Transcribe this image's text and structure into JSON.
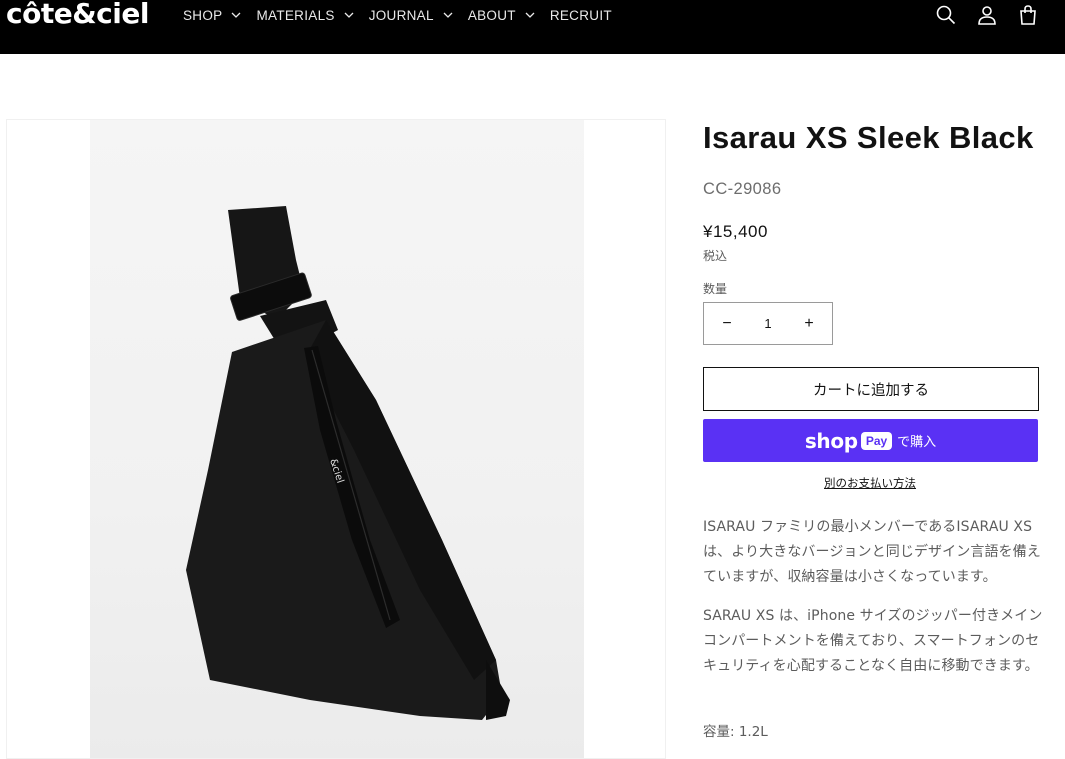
{
  "header": {
    "logo": "côte&ciel",
    "nav": [
      {
        "label": "SHOP",
        "has_dropdown": true
      },
      {
        "label": "MATERIALS",
        "has_dropdown": true
      },
      {
        "label": "JOURNAL",
        "has_dropdown": true
      },
      {
        "label": "ABOUT",
        "has_dropdown": true
      },
      {
        "label": "RECRUIT",
        "has_dropdown": false
      }
    ],
    "icons": [
      "search-icon",
      "account-icon",
      "cart-icon"
    ]
  },
  "product": {
    "title": "Isarau XS Sleek Black",
    "sku": "CC-29086",
    "price": "¥15,400",
    "tax_note": "税込",
    "quantity_label": "数量",
    "quantity_value": "1",
    "decrease_symbol": "−",
    "increase_symbol": "+",
    "add_to_cart": "カートに追加する",
    "shop_pay": {
      "shop": "shop",
      "pay": "Pay",
      "buy": "で購入"
    },
    "other_payment": "別のお支払い方法",
    "description": [
      "ISARAU ファミリの最小メンバーであるISARAU XSは、より大きなバージョンと同じデザイン言語を備えていますが、収納容量は小さくなっています。",
      "SARAU XS は、iPhone サイズのジッパー付きメインコンパートメントを備えており、スマートフォンのセキュリティを心配することなく自由に移動できます。"
    ],
    "capacity": "容量: 1.2L"
  },
  "colors": {
    "header_bg": "#000000",
    "shop_pay": "#5a31f4",
    "text": "#121212",
    "muted": "#5c5c5c"
  }
}
